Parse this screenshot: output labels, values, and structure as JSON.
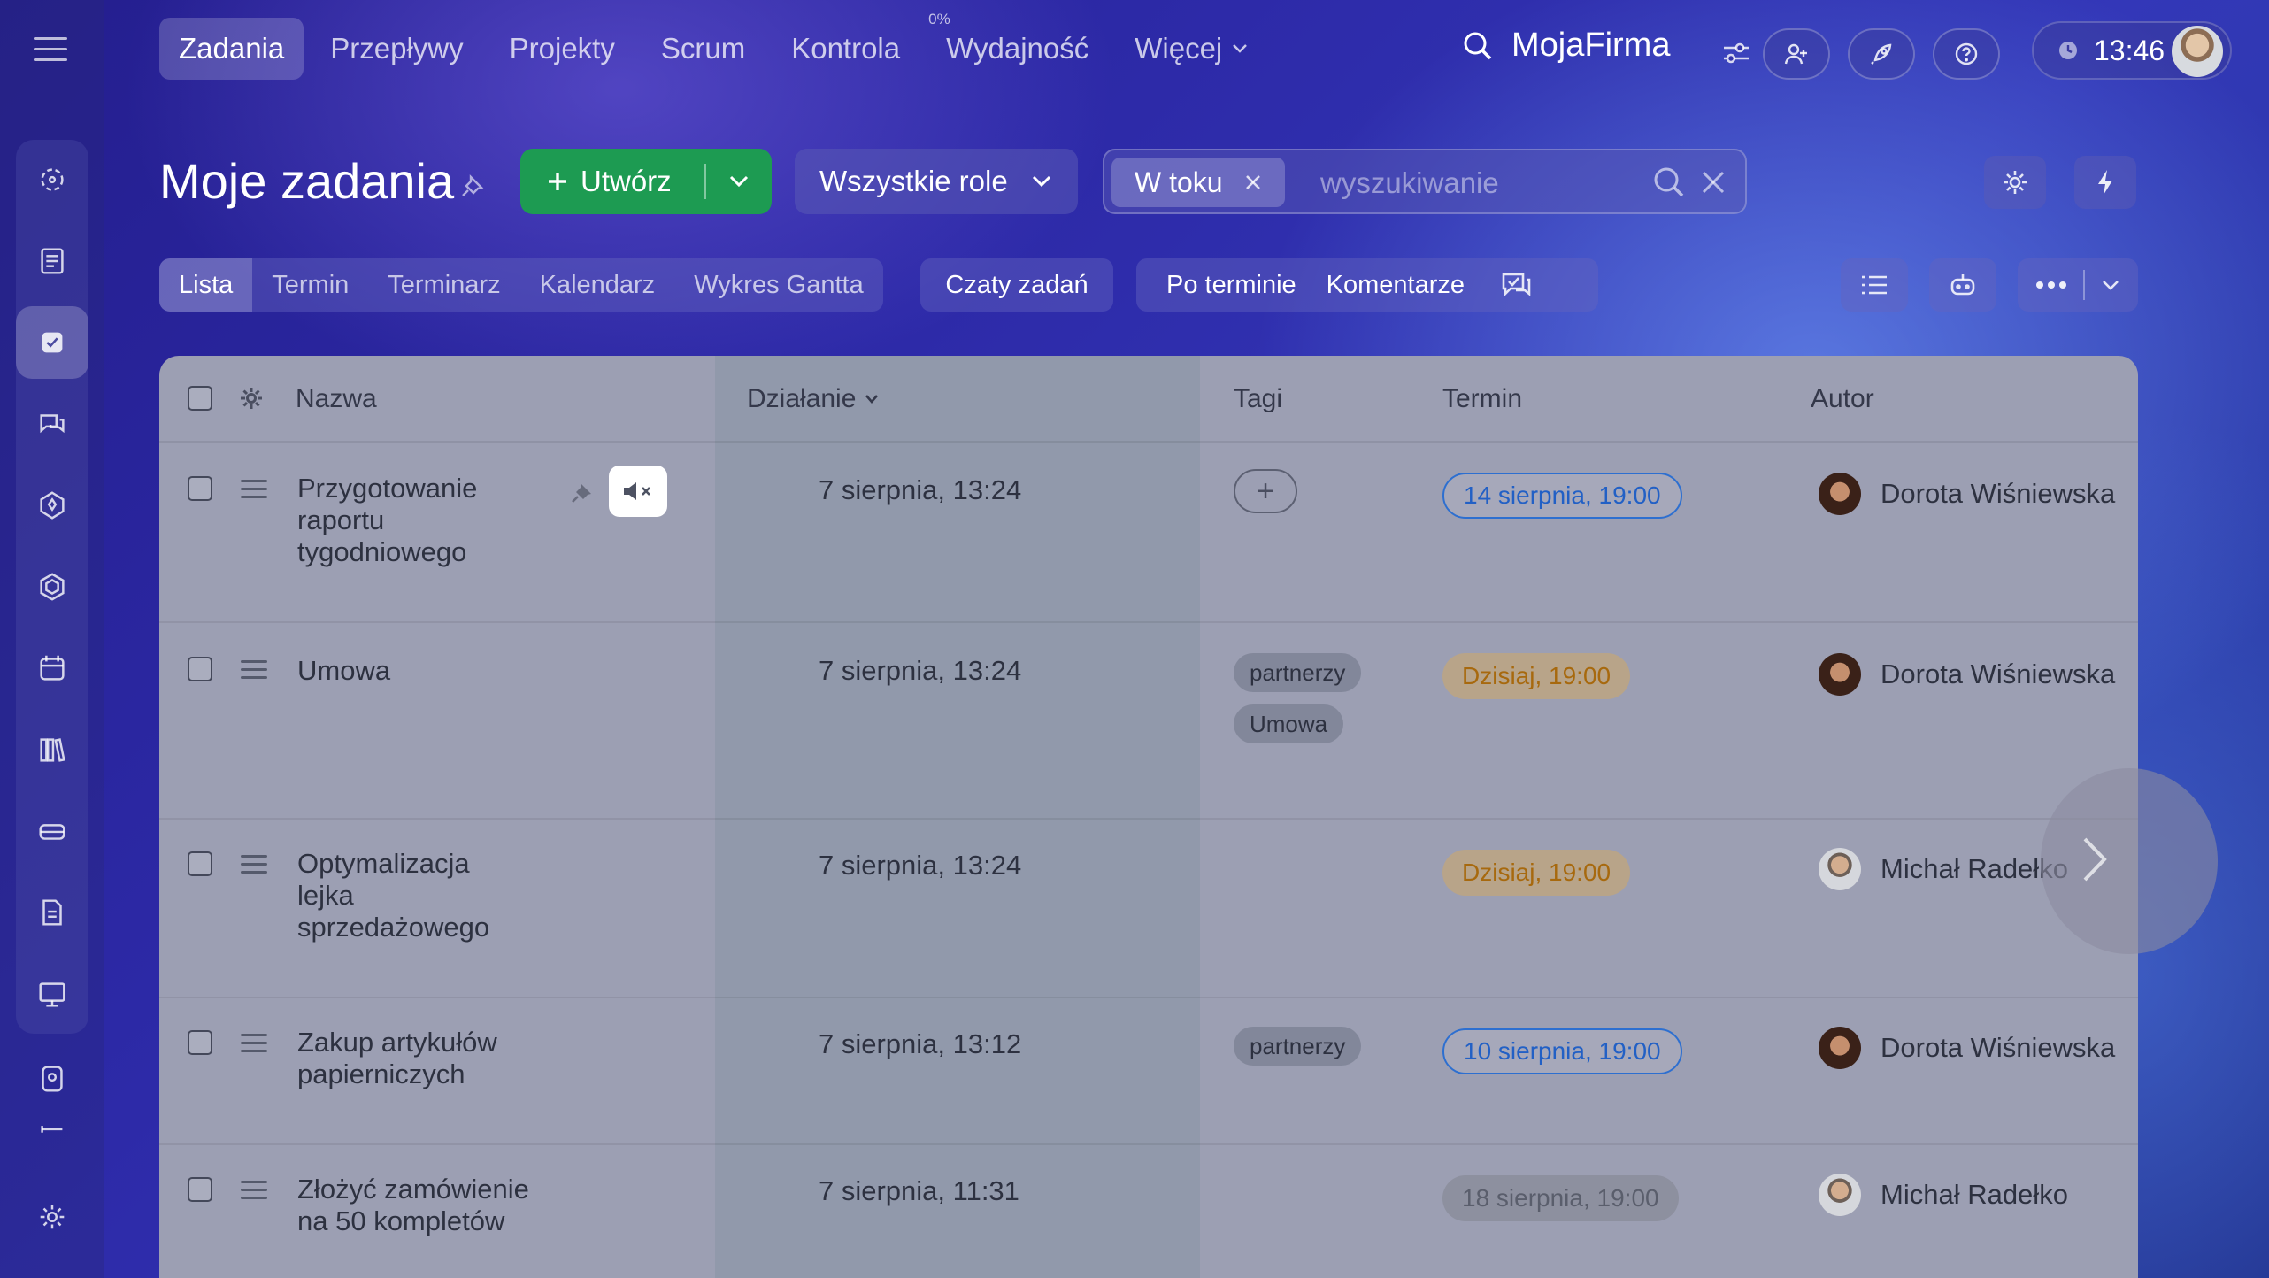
{
  "nav": {
    "items": [
      "Zadania",
      "Przepływy",
      "Projekty",
      "Scrum",
      "Kontrola",
      "Wydajność",
      "Więcej"
    ],
    "efficiency_badge": "0%",
    "brand": "MojaFirma",
    "time": "13:46"
  },
  "header": {
    "title": "Moje zadania",
    "create_label": "Utwórz",
    "roles_label": "Wszystkie role",
    "filter_chip": "W toku",
    "search_placeholder": "wyszukiwanie"
  },
  "views": {
    "tabs": [
      "Lista",
      "Termin",
      "Terminarz",
      "Kalendarz",
      "Wykres Gantta"
    ],
    "active": "Lista",
    "chats": "Czaty zadań",
    "overdue": "Po terminie",
    "comments": "Komentarze"
  },
  "table": {
    "columns": {
      "name": "Nazwa",
      "action": "Działanie",
      "tags": "Tagi",
      "due": "Termin",
      "author": "Autor"
    },
    "rows": [
      {
        "name": "Przygotowanie raportu tygodniowego",
        "action": "7 sierpnia, 13:24",
        "tags": [],
        "due": "14 sierpnia, 19:00",
        "due_style": "blue",
        "author": "Dorota Wiśniewska"
      },
      {
        "name": "Umowa",
        "action": "7 sierpnia, 13:24",
        "tags": [
          "partnerzy",
          "Umowa"
        ],
        "due": "Dzisiaj, 19:00",
        "due_style": "orange",
        "author": "Dorota Wiśniewska"
      },
      {
        "name": "Optymalizacja lejka sprzedażowego",
        "action": "7 sierpnia, 13:24",
        "tags": [],
        "due": "Dzisiaj, 19:00",
        "due_style": "orange",
        "author": "Michał Radełko"
      },
      {
        "name": "Zakup artykułów papierniczych",
        "action": "7 sierpnia, 13:12",
        "tags": [
          "partnerzy"
        ],
        "due": "10 sierpnia, 19:00",
        "due_style": "blue",
        "author": "Dorota Wiśniewska"
      },
      {
        "name": "Złożyć zamówienie na 50 kompletów",
        "action": "7 sierpnia, 11:31",
        "tags": [],
        "due": "18 sierpnia, 19:00",
        "due_style": "grey",
        "author": "Michał Radełko"
      }
    ]
  }
}
